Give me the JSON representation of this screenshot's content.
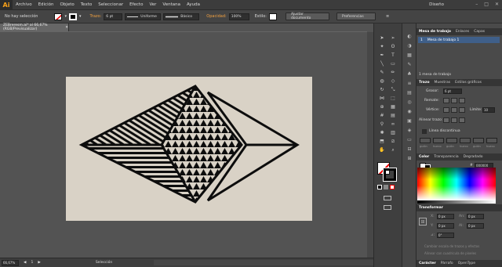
{
  "menubar": {
    "logo": "Ai",
    "items": [
      "Archivo",
      "Edición",
      "Objeto",
      "Texto",
      "Seleccionar",
      "Efecto",
      "Ver",
      "Ventana",
      "Ayuda"
    ],
    "workspace": "Diseño",
    "win_min": "–",
    "win_max": "□",
    "win_close": "✕"
  },
  "controlbar": {
    "selection_label": "No hay selección",
    "stroke_label": "Trazo:",
    "stroke_value": "6 pt",
    "profile_value": "Uniforme",
    "brush_value": "Básico",
    "opacity_label": "Opacidad:",
    "opacity_value": "100%",
    "style_label": "Estilo:",
    "doc_setup_button": "Ajustar documento",
    "prefs_button": "Preferencias"
  },
  "document_tab": {
    "title": "ZEBreresm.ai* al 66,67% (RGB/Previsualizar)",
    "close": "✕"
  },
  "statusbar": {
    "zoom": "66,67%",
    "artboard_num": "1",
    "mode": "Selección"
  },
  "panels": {
    "artboards": {
      "tabs": [
        "Mesa de trabajo",
        "Enlaces",
        "Capas"
      ],
      "item_num": "1",
      "item_name": "Mesa de trabajo 1",
      "footer": "1 mesa de trabajo"
    },
    "stroke": {
      "tabs": [
        "Trazo",
        "Muestras",
        "Estilos gráficos"
      ],
      "weight_label": "Grosor:",
      "weight_value": "6 pt",
      "cap_label": "Remate:",
      "corner_label": "Vértice:",
      "limit_label": "Límite:",
      "limit_value": "10",
      "align_label": "Alinear trazo:",
      "dashed_label": "Línea discontinua",
      "dash_labels": [
        "guión",
        "hueco",
        "guión",
        "hueco",
        "guión",
        "hueco"
      ]
    },
    "color": {
      "tabs": [
        "Color",
        "Transparencia",
        "Degradado"
      ],
      "hex_symbol": "#",
      "hex_value": "000000"
    },
    "transform": {
      "tabs": [
        "Transformar"
      ],
      "x_label": "X:",
      "x_value": "0 px",
      "y_label": "Y:",
      "y_value": "0 px",
      "w_label": "An:",
      "w_value": "0 px",
      "h_label": "Al:",
      "h_value": "0 px",
      "a_label": "⊿:",
      "a_value": "0°",
      "scale_check": "Cambiar escala de trazos y efectos",
      "pixel_check": "Alinear con cuadrícula de píxeles"
    },
    "character": {
      "tabs": [
        "Carácter",
        "Párrafo",
        "OpenType"
      ]
    }
  },
  "colors": {
    "artboard": "#d9d2c6",
    "ink": "#0d0d0d",
    "accent": "#f7a11a"
  }
}
